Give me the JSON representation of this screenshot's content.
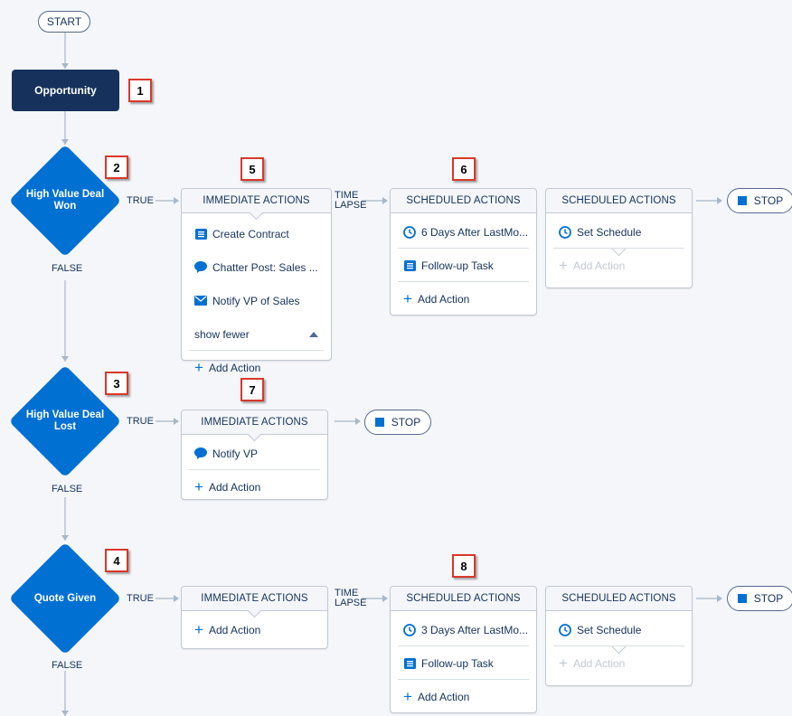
{
  "start_label": "START",
  "objects": [
    {
      "label": "Opportunity",
      "marker": "1"
    }
  ],
  "stop_label": "STOP",
  "time_lapse_label": [
    "TIME",
    "LAPSE"
  ],
  "criteria": [
    {
      "label_lines": [
        "High Value Deal",
        "Won"
      ],
      "marker": "2",
      "true_label": "TRUE",
      "false_label": "FALSE"
    },
    {
      "label_lines": [
        "High Value Deal",
        "Lost"
      ],
      "marker": "3",
      "true_label": "TRUE",
      "false_label": "FALSE"
    },
    {
      "label_lines": [
        "Quote Given"
      ],
      "marker": "4",
      "true_label": "TRUE",
      "false_label": "FALSE"
    }
  ],
  "markers": {
    "m5": "5",
    "m6": "6",
    "m7": "7",
    "m8": "8"
  },
  "cards": {
    "imm1": {
      "title": "IMMEDIATE ACTIONS",
      "items": [
        "Create Contract",
        "Chatter Post: Sales ...",
        "Notify VP of Sales"
      ],
      "show_fewer": "show fewer",
      "add": "Add Action"
    },
    "sch1a": {
      "title": "SCHEDULED ACTIONS",
      "schedule": "6 Days After LastMo...",
      "items": [
        "Follow-up Task"
      ],
      "add": "Add Action"
    },
    "sch1b": {
      "title": "SCHEDULED ACTIONS",
      "schedule": "Set Schedule",
      "add": "Add Action"
    },
    "imm2": {
      "title": "IMMEDIATE ACTIONS",
      "items": [
        "Notify VP"
      ],
      "add": "Add Action"
    },
    "imm3": {
      "title": "IMMEDIATE ACTIONS",
      "add": "Add Action"
    },
    "sch3a": {
      "title": "SCHEDULED ACTIONS",
      "schedule": "3 Days After LastMo...",
      "items": [
        "Follow-up Task"
      ],
      "add": "Add Action"
    },
    "sch3b": {
      "title": "SCHEDULED ACTIONS",
      "schedule": "Set Schedule",
      "add": "Add Action"
    }
  },
  "colors": {
    "accent": "#0070d2",
    "navy": "#16325c",
    "marker_border": "#d9382b",
    "background": "#f4f6f9"
  },
  "icons": {
    "task": "task-list-icon",
    "chatter": "chat-bubble-icon",
    "email": "envelope-icon",
    "clock": "clock-icon",
    "plus": "plus-icon",
    "stop": "stop-square-icon",
    "expand": "triangle-up-icon"
  }
}
